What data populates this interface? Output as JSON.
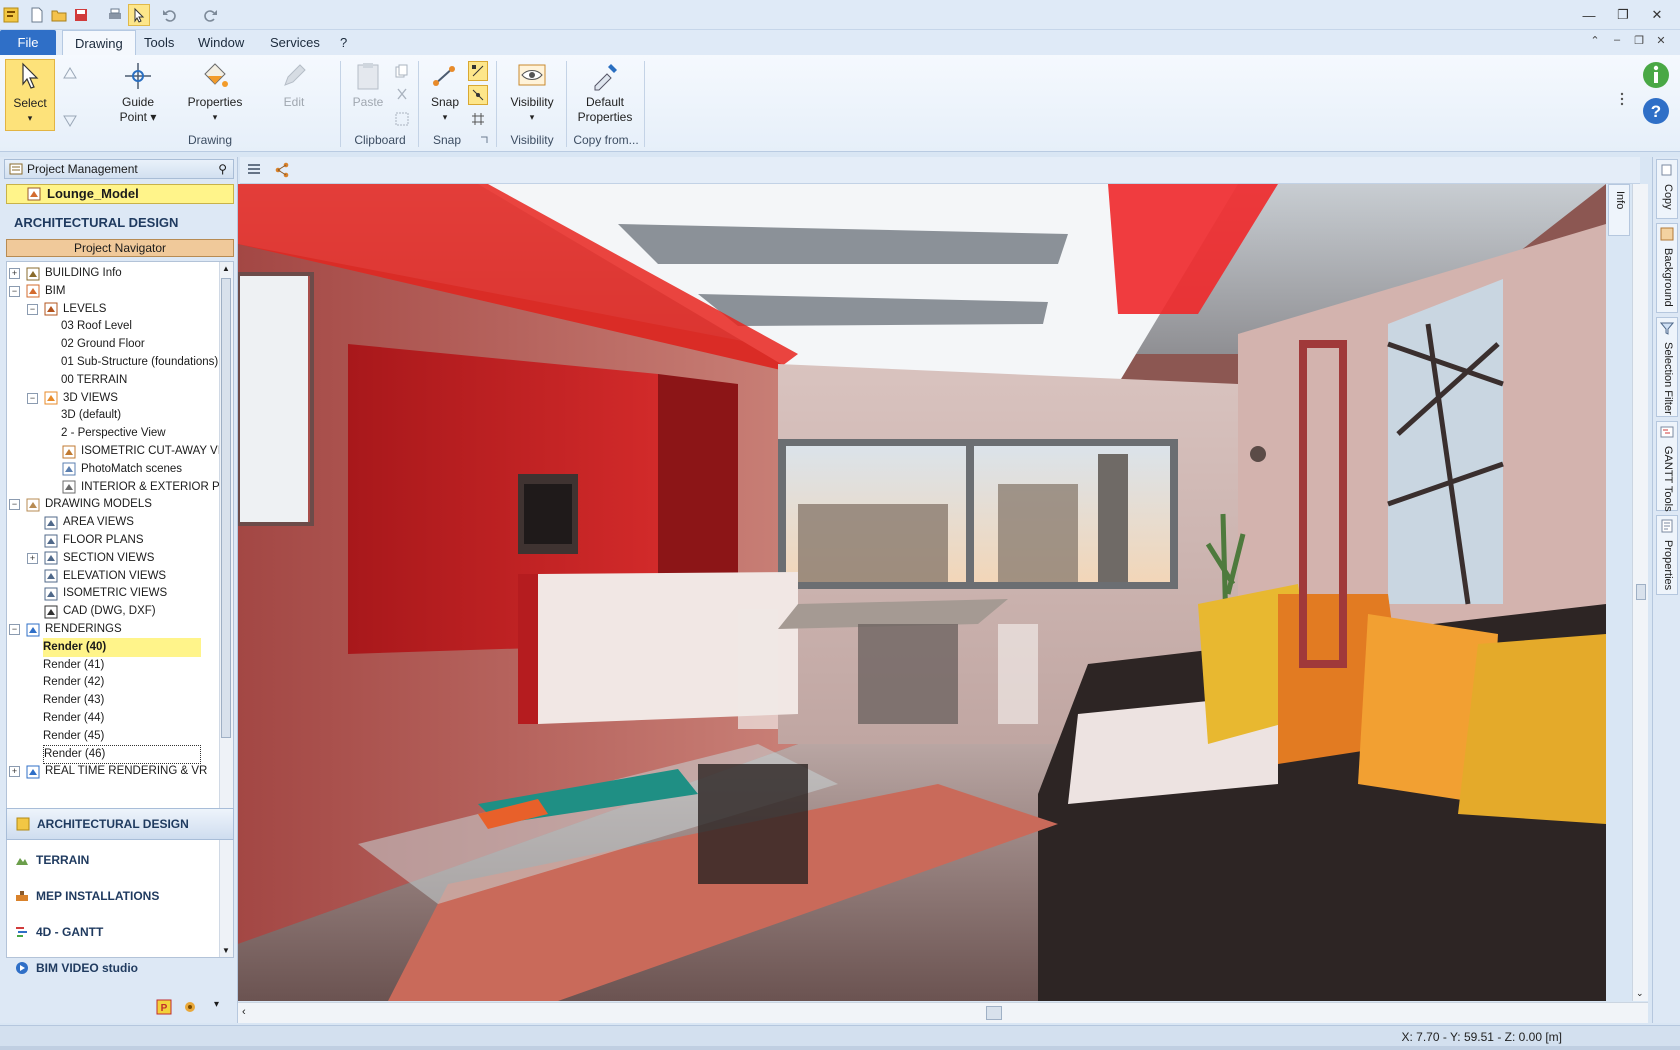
{
  "menu": {
    "file": "File",
    "tabs": [
      "Drawing",
      "Tools",
      "Window",
      "Services",
      "?"
    ]
  },
  "ribbon": {
    "select": "Select",
    "guide_point": [
      "Guide",
      "Point ▾"
    ],
    "properties": [
      "Properties",
      "▾"
    ],
    "edit": "Edit",
    "paste": "Paste",
    "snap": [
      "Snap",
      "▾"
    ],
    "visibility": [
      "Visibility",
      "▾"
    ],
    "default_properties": [
      "Default",
      "Properties"
    ],
    "groups": [
      "Drawing",
      "Clipboard",
      "Snap",
      "Visibility",
      "Copy from..."
    ]
  },
  "project_panel": {
    "header": "Project Management",
    "model_name": "Lounge_Model",
    "section_title": "ARCHITECTURAL DESIGN",
    "navigator": "Project Navigator",
    "tree": [
      {
        "label": "BUILDING Info",
        "level": 0,
        "exp": "+",
        "icon": "building-icon"
      },
      {
        "label": "BIM",
        "level": 0,
        "exp": "−",
        "icon": "bim-icon"
      },
      {
        "label": "LEVELS",
        "level": 1,
        "exp": "−",
        "icon": "levels-icon"
      },
      {
        "label": "03 Roof Level",
        "level": 2
      },
      {
        "label": "02 Ground Floor",
        "level": 2
      },
      {
        "label": "01 Sub-Structure (foundations)",
        "level": 2
      },
      {
        "label": "00 TERRAIN",
        "level": 2
      },
      {
        "label": "3D VIEWS",
        "level": 1,
        "exp": "−",
        "icon": "3d-views-icon"
      },
      {
        "label": "3D (default)",
        "level": 2
      },
      {
        "label": "2 - Perspective View",
        "level": 2
      },
      {
        "label": "ISOMETRIC CUT-AWAY VIE",
        "level": 2,
        "icon": "isometric-icon"
      },
      {
        "label": "PhotoMatch scenes",
        "level": 2,
        "icon": "photomatch-icon"
      },
      {
        "label": "INTERIOR & EXTERIOR PHO",
        "level": 2,
        "icon": "photo-icon"
      },
      {
        "label": "DRAWING MODELS",
        "level": 0,
        "exp": "−",
        "icon": "drawing-models-icon"
      },
      {
        "label": "AREA VIEWS",
        "level": 1,
        "icon": "area-views-icon"
      },
      {
        "label": "FLOOR PLANS",
        "level": 1,
        "icon": "floor-plans-icon"
      },
      {
        "label": "SECTION VIEWS",
        "level": 1,
        "exp": "+",
        "icon": "section-views-icon"
      },
      {
        "label": "ELEVATION VIEWS",
        "level": 1,
        "icon": "elevation-views-icon"
      },
      {
        "label": "ISOMETRIC VIEWS",
        "level": 1,
        "icon": "isometric-views-icon"
      },
      {
        "label": "CAD (DWG, DXF)",
        "level": 1,
        "icon": "cad-icon"
      },
      {
        "label": "RENDERINGS",
        "level": 0,
        "exp": "−",
        "icon": "renderings-icon"
      },
      {
        "label": "Render (40)",
        "level": 1,
        "state": "highlighted"
      },
      {
        "label": "Render (41)",
        "level": 1
      },
      {
        "label": "Render (42)",
        "level": 1
      },
      {
        "label": "Render (43)",
        "level": 1
      },
      {
        "label": "Render (44)",
        "level": 1
      },
      {
        "label": "Render (45)",
        "level": 1
      },
      {
        "label": "Render (46)",
        "level": 1,
        "state": "focused"
      },
      {
        "label": "REAL TIME RENDERING & VR",
        "level": 0,
        "exp": "+",
        "icon": "realtime-icon"
      }
    ],
    "modules": [
      "ARCHITECTURAL DESIGN",
      "TERRAIN",
      "MEP INSTALLATIONS",
      "4D - GANTT",
      "BIM VIDEO studio"
    ]
  },
  "viewport": {
    "info_tab": "Info"
  },
  "right_dock": [
    "Copy",
    "Background",
    "Selection Filter",
    "GANTT Tools",
    "Properties"
  ],
  "status": {
    "coords": "X: 7.70 - Y: 59.51 - Z: 0.00 [m]"
  },
  "colors": {
    "accent_blue": "#2f6fc7",
    "highlight_yellow": "#fff48a",
    "ribbon_bg": "#e6eff9",
    "navigator_bar": "#f0c99a",
    "led_red": "#ff1a1a"
  }
}
